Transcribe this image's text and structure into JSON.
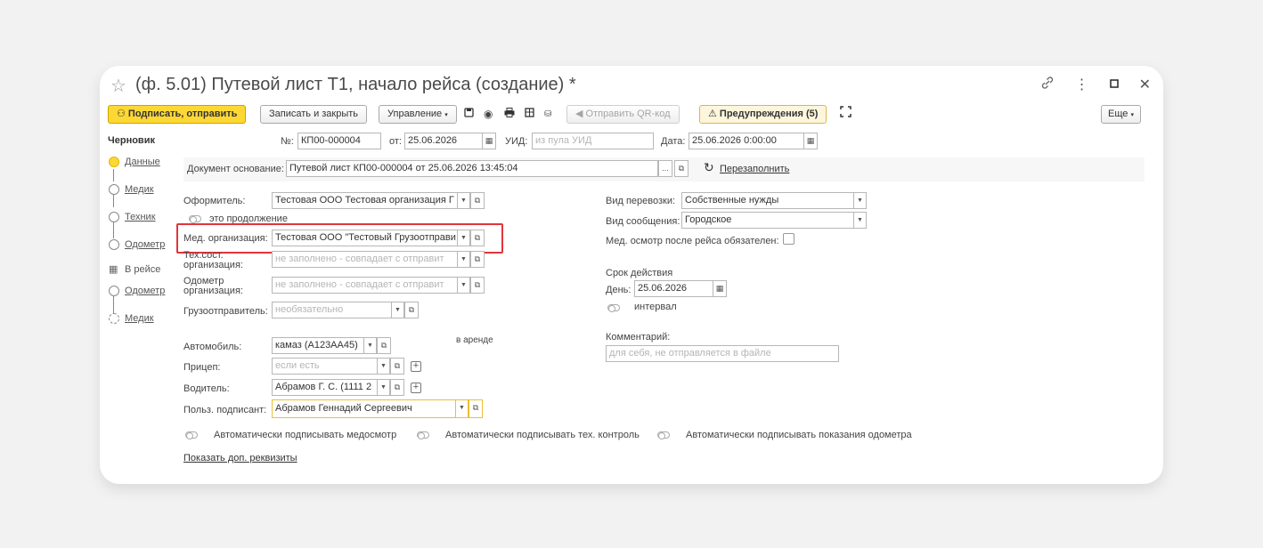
{
  "window": {
    "title": "(ф. 5.01) Путевой лист Т1, начало рейса (создание) *",
    "icons": [
      "star-icon",
      "link-icon",
      "more-icon",
      "maximize-icon",
      "close-icon"
    ]
  },
  "toolbar": {
    "sign_send": "Подписать, отправить",
    "save_close": "Записать и закрыть",
    "manage": "Управление",
    "send_qr": "Отправить QR-код",
    "warnings": "Предупреждения (5)",
    "more": "Еще"
  },
  "sidebar": {
    "status": "Черновик",
    "steps": [
      {
        "label": "Данные",
        "state": "active"
      },
      {
        "label": "Медик",
        "state": "done"
      },
      {
        "label": "Техник",
        "state": "done"
      },
      {
        "label": "Одометр",
        "state": "done"
      },
      {
        "label": "В рейсе",
        "state": "qr"
      },
      {
        "label": "Одометр",
        "state": "done"
      },
      {
        "label": "Медик",
        "state": "pending"
      }
    ]
  },
  "header": {
    "number_label": "№:",
    "number": "КП00-000004",
    "date_label": "от:",
    "date": "25.06.2026",
    "uid_label": "УИД:",
    "uid_placeholder": "из пула УИД",
    "datetime_label": "Дата:",
    "datetime": "25.06.2026  0:00:00"
  },
  "basis": {
    "label": "Документ основание:",
    "value": "Путевой лист КП00-000004 от 25.06.2026 13:45:04",
    "select": "...",
    "refill": "Перезаполнить"
  },
  "left": {
    "issuer_label": "Оформитель:",
    "issuer": "Тестовая ООО Тестовая организация Г",
    "continuation": "это продолжение",
    "med_label": "Мед. организация:",
    "med": "Тестовая ООО \"Тестовый Грузоотправи",
    "tech_label": "Тех.сост. организация:",
    "tech_placeholder": "не заполнено - совпадает с отправит",
    "odo_label": "Одометр организация:",
    "odo_placeholder": "не заполнено - совпадает с отправит",
    "shipper_label": "Грузоотправитель:",
    "shipper_placeholder": "необязательно",
    "car_label": "Автомобиль:",
    "car": "камаз (А123АА45)",
    "rent": "в аренде",
    "trailer_label": "Прицеп:",
    "trailer_placeholder": "если есть",
    "driver_label": "Водитель:",
    "driver": "Абрамов Г. С. (1111 2",
    "signer_label": "Польз. подписант:",
    "signer": "Абрамов Геннадий Сергеевич"
  },
  "right": {
    "transport_label": "Вид перевозки:",
    "transport": "Собственные нужды",
    "route_label": "Вид сообщения:",
    "route": "Городское",
    "med_after_label": "Мед. осмотр после рейса обязателен:",
    "validity_label": "Срок действия",
    "day_label": "День:",
    "day": "25.06.2026",
    "interval": "интервал",
    "comment_label": "Комментарий:",
    "comment_placeholder": "для себя, не отправляется в файле"
  },
  "auto_sign": {
    "med": "Автоматически подписывать медосмотр",
    "tech": "Автоматически подписывать тех. контроль",
    "odo": "Автоматически подписывать показания одометра"
  },
  "show_more": "Показать доп. реквизиты"
}
